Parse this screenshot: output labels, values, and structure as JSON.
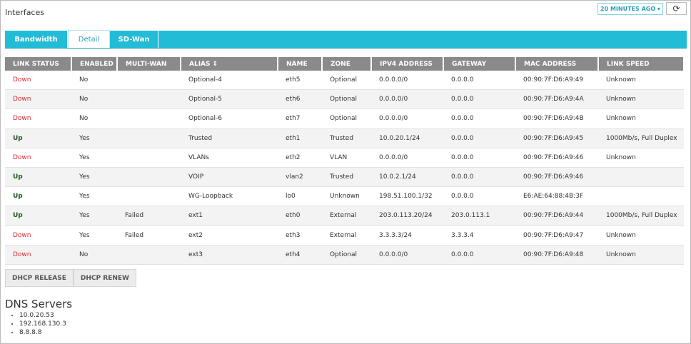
{
  "header": {
    "title": "Interfaces",
    "time_range": "20 MINUTES AGO",
    "refresh_icon": "refresh-icon"
  },
  "tabs": [
    {
      "label": "Bandwidth"
    },
    {
      "label": "Detail",
      "active": true
    },
    {
      "label": "SD-Wan"
    }
  ],
  "table": {
    "columns": [
      "LINK STATUS",
      "ENABLED",
      "MULTI-WAN",
      "ALIAS",
      "NAME",
      "ZONE",
      "IPV4 ADDRESS",
      "GATEWAY",
      "MAC ADDRESS",
      "LINK SPEED"
    ],
    "sort_icon": "sort-icon",
    "rows": [
      [
        "Down",
        "No",
        "",
        "Optional-4",
        "eth5",
        "Optional",
        "0.0.0.0/0",
        "0.0.0.0",
        "00:90:7F:D6:A9:49",
        "Unknown"
      ],
      [
        "Down",
        "No",
        "",
        "Optional-5",
        "eth6",
        "Optional",
        "0.0.0.0/0",
        "0.0.0.0",
        "00:90:7F:D6:A9:4A",
        "Unknown"
      ],
      [
        "Down",
        "No",
        "",
        "Optional-6",
        "eth7",
        "Optional",
        "0.0.0.0/0",
        "0.0.0.0",
        "00:90:7F:D6:A9:4B",
        "Unknown"
      ],
      [
        "Up",
        "Yes",
        "",
        "Trusted",
        "eth1",
        "Trusted",
        "10.0.20.1/24",
        "0.0.0.0",
        "00:90:7F:D6:A9:45",
        "1000Mb/s, Full Duplex"
      ],
      [
        "Down",
        "Yes",
        "",
        "VLANs",
        "eth2",
        "VLAN",
        "0.0.0.0/0",
        "0.0.0.0",
        "00:90:7F:D6:A9:46",
        "Unknown"
      ],
      [
        "Up",
        "Yes",
        "",
        "VOIP",
        "vlan2",
        "Trusted",
        "10.0.2.1/24",
        "0.0.0.0",
        "00:90:7F:D6:A9:46",
        ""
      ],
      [
        "Up",
        "Yes",
        "",
        "WG-Loopback",
        "lo0",
        "Unknown",
        "198.51.100.1/32",
        "0.0.0.0",
        "E6:AE:64:88:4B:3F",
        ""
      ],
      [
        "Up",
        "Yes",
        "Failed",
        "ext1",
        "eth0",
        "External",
        "203.0.113.20/24",
        "203.0.113.1",
        "00:90:7F:D6:A9:44",
        "1000Mb/s, Full Duplex"
      ],
      [
        "Down",
        "Yes",
        "Failed",
        "ext2",
        "eth3",
        "External",
        "3.3.3.3/24",
        "3.3.3.4",
        "00:90:7F:D6:A9:47",
        "Unknown"
      ],
      [
        "Down",
        "No",
        "",
        "ext3",
        "eth4",
        "Optional",
        "0.0.0.0/0",
        "0.0.0.0",
        "00:90:7F:D6:A9:48",
        "Unknown"
      ]
    ]
  },
  "buttons": {
    "release": "DHCP RELEASE",
    "renew": "DHCP RENEW"
  },
  "dns": {
    "title": "DNS Servers",
    "servers": [
      "10.0.20.53",
      "192.168.130.3",
      "8.8.8.8"
    ]
  },
  "colors": {
    "accent": "#22bcd6",
    "down": "#e0262e",
    "up": "#1e5a1e",
    "header": "#8a8a8a"
  }
}
